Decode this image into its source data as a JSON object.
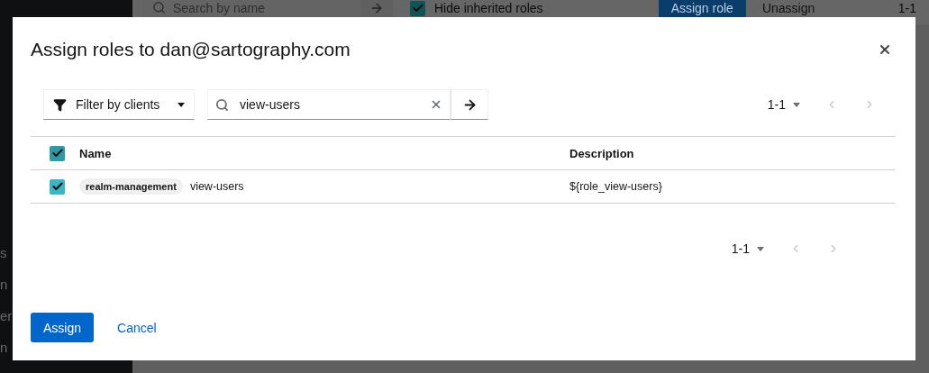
{
  "background": {
    "sidebar_items": [
      "s",
      "n",
      "er",
      "n"
    ],
    "toolbar": {
      "search_placeholder": "Search by name",
      "hide_inherited": {
        "label": "Hide inherited roles",
        "checked": true
      },
      "buttons": [
        {
          "label": "Assign role",
          "kind": "primary"
        },
        {
          "label": "Unassign",
          "kind": "plain"
        }
      ],
      "pagination": "1-1"
    }
  },
  "dialog": {
    "title": "Assign roles to dan@sartography.com",
    "filter": "Filter by clients",
    "search": {
      "value": "view-users"
    },
    "pagination_top": "1-1",
    "table": {
      "select_all_checked": true,
      "columns": [
        "Name",
        "Description"
      ],
      "rows": [
        {
          "checked": true,
          "client": "realm-management",
          "name": "view-users",
          "description": "${role_view-users}"
        }
      ]
    },
    "pagination_bottom": "1-1",
    "buttons": [
      {
        "label": "Assign",
        "kind": "primary"
      },
      {
        "label": "Cancel",
        "kind": "link"
      }
    ]
  }
}
